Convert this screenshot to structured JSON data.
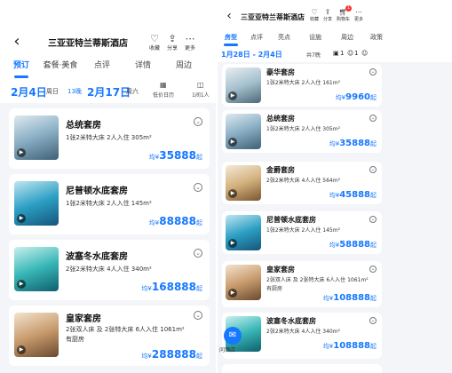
{
  "left": {
    "hotel_name": "三亚亚特兰蒂斯酒店",
    "actions": [
      {
        "icon": "heart-icon",
        "label": "收藏"
      },
      {
        "icon": "share-icon",
        "label": "分享"
      },
      {
        "icon": "more-icon",
        "label": "更多"
      }
    ],
    "tabs": [
      "预订",
      "套餐·美食",
      "点评",
      "详情",
      "周边"
    ],
    "checkin_date": "2月4日",
    "checkin_day": "周日",
    "nights": "13晚",
    "checkout_date": "2月17日",
    "checkout_day": "周六",
    "calendar_label": "低价日历",
    "guests_label": "1间1人",
    "price_prefix": "均¥",
    "price_suffix": "起",
    "rooms": [
      {
        "name": "总统套房",
        "info": "1张2米特大床  2人入住  305m²",
        "price": "35888"
      },
      {
        "name": "尼普顿水底套房",
        "info": "1张2米特大床  2人入住  145m²",
        "price": "88888"
      },
      {
        "name": "波塞冬水底套房",
        "info": "2张2米特大床  4人入住  340m²",
        "price": "168888"
      },
      {
        "name": "皇家套房",
        "info": "2张双人床 及 2张特大床  6人入住  1061m²",
        "extra": "有厨房",
        "price": "288888"
      }
    ]
  },
  "right": {
    "hotel_name": "三亚亚特兰蒂斯酒店",
    "actions": [
      {
        "icon": "heart-icon",
        "label": "收藏"
      },
      {
        "icon": "share-icon",
        "label": "分享"
      },
      {
        "icon": "cart-icon",
        "label": "购物车"
      },
      {
        "icon": "more-icon",
        "label": "更多"
      }
    ],
    "cart_badge": "1",
    "tabs": [
      "房型",
      "点评",
      "亮点",
      "设施",
      "周边",
      "政策"
    ],
    "date_range": "1月28日 - 2月4日",
    "nights": "共7晚",
    "rooms_count": "1",
    "guests_count": "1",
    "price_prefix": "均¥",
    "price_suffix": "起",
    "rooms": [
      {
        "name": "豪华套房",
        "info": "1张2米特大床  2人入住  161m²",
        "price": "9960"
      },
      {
        "name": "总统套房",
        "info": "1张2米特大床  2人入住  305m²",
        "price": "35888"
      },
      {
        "name": "金爵套房",
        "info": "2张2米特大床  4人入住  564m²",
        "price": "45888"
      },
      {
        "name": "尼普顿水底套房",
        "info": "1张2米特大床  2人入住  145m²",
        "price": "58888"
      },
      {
        "name": "皇家套房",
        "info": "2张双人床 及 2张特大床  6人入住  1061m²",
        "extra": "有厨房",
        "price": "108888"
      },
      {
        "name": "波塞冬水底套房",
        "info": "2张2米特大床  4人入住  340m²",
        "price": "108888"
      }
    ],
    "fab_label": "问酒店"
  }
}
